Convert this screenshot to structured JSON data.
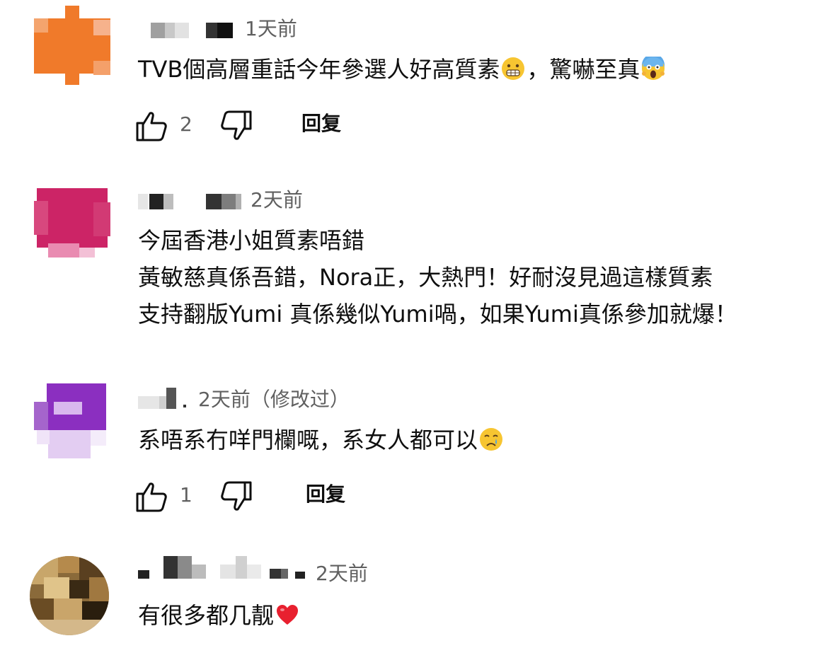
{
  "comments": [
    {
      "time": "1天前",
      "lines": [
        "TVB個高層重話今年參選人好高質素",
        "，驚嚇至真"
      ],
      "likes": "2",
      "reply_label": "回复"
    },
    {
      "time": "2天前",
      "lines": [
        "今屆香港小姐質素唔錯",
        "黃敏慈真係吾錯，Nora正，大熱門！好耐沒見過這樣質素",
        "支持翻版Yumi  真係幾似Yumi喎，如果Yumi真係參加就爆！"
      ]
    },
    {
      "time": "2天前（修改过）",
      "lines": [
        "系唔系冇咩門欄嘅，系女人都可以"
      ],
      "likes": "1",
      "reply_label": "回复"
    },
    {
      "time": "2天前",
      "lines": [
        "有很多都几靓"
      ]
    }
  ],
  "icons": {
    "like": "thumb-up-icon",
    "dislike": "thumb-down-icon",
    "emoji_grimace": "grimacing-face-emoji",
    "emoji_scream": "screaming-face-emoji",
    "emoji_cry": "crying-face-emoji",
    "emoji_heart": "red-heart-emoji"
  },
  "colors": {
    "text": "#0f0f0f",
    "meta": "#606060"
  }
}
